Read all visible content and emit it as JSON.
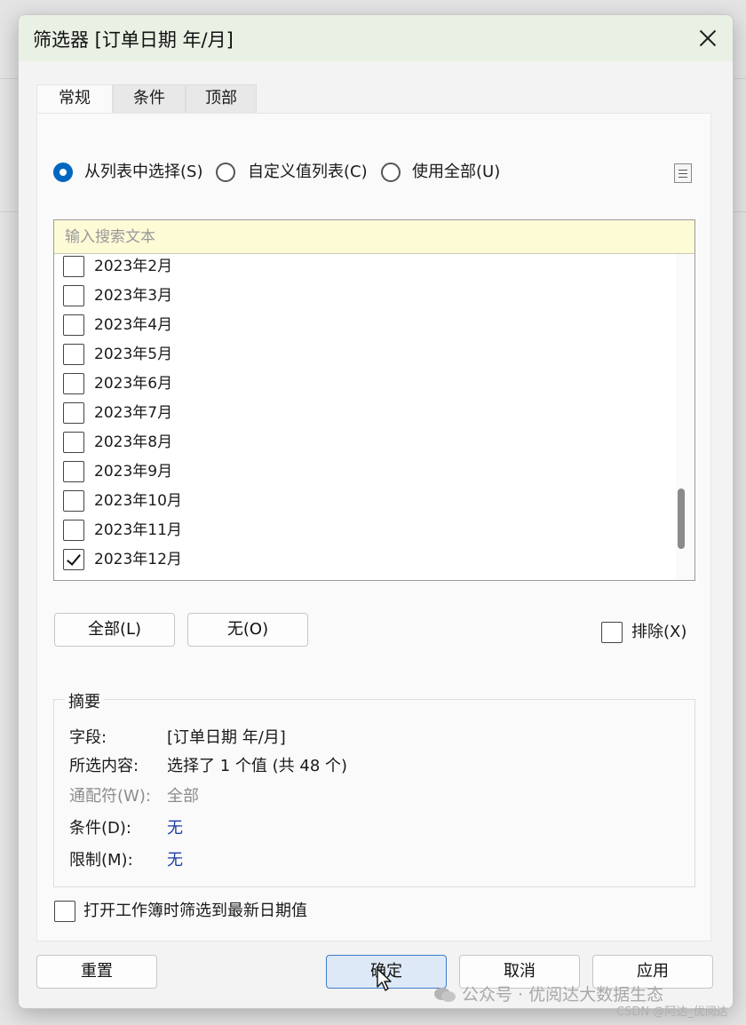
{
  "dialog": {
    "title": "筛选器 [订单日期 年/月]"
  },
  "tabs": [
    {
      "label": "常规",
      "active": true
    },
    {
      "label": "条件",
      "active": false
    },
    {
      "label": "顶部",
      "active": false
    }
  ],
  "mode": {
    "options": [
      {
        "label": "从列表中选择(S)",
        "selected": true
      },
      {
        "label": "自定义值列表(C)",
        "selected": false
      },
      {
        "label": "使用全部(U)",
        "selected": false
      }
    ]
  },
  "search": {
    "placeholder": "输入搜索文本",
    "value": ""
  },
  "items": [
    {
      "label": "2023年2月",
      "checked": false
    },
    {
      "label": "2023年3月",
      "checked": false
    },
    {
      "label": "2023年4月",
      "checked": false
    },
    {
      "label": "2023年5月",
      "checked": false
    },
    {
      "label": "2023年6月",
      "checked": false
    },
    {
      "label": "2023年7月",
      "checked": false
    },
    {
      "label": "2023年8月",
      "checked": false
    },
    {
      "label": "2023年9月",
      "checked": false
    },
    {
      "label": "2023年10月",
      "checked": false
    },
    {
      "label": "2023年11月",
      "checked": false
    },
    {
      "label": "2023年12月",
      "checked": true
    }
  ],
  "list_buttons": {
    "all_label": "全部(L)",
    "none_label": "无(O)",
    "exclude_label": "排除(X)",
    "exclude_checked": false
  },
  "summary": {
    "title": "摘要",
    "rows": [
      {
        "key": "字段:",
        "value": "[订单日期 年/月]"
      },
      {
        "key": "所选内容:",
        "value": "选择了 1 个值 (共 48 个)"
      },
      {
        "key": "通配符(W):",
        "value": "全部"
      },
      {
        "key": "条件(D):",
        "value": "无"
      },
      {
        "key": "限制(M):",
        "value": "无"
      }
    ]
  },
  "open_latest": {
    "label": "打开工作簿时筛选到最新日期值",
    "checked": false
  },
  "footer": {
    "reset_label": "重置",
    "ok_label": "确定",
    "cancel_label": "取消",
    "apply_label": "应用"
  },
  "watermark": {
    "text": "公众号 · 优阅达大数据生态",
    "csdn": "CSDN @阿达_优阅达"
  },
  "colors": {
    "accent": "#0067c0",
    "title_bar": "#e9f1e5",
    "search_bg": "#fdfad6",
    "link_blue": "#1b3fa8"
  },
  "icons": {
    "close": "close-icon",
    "list_menu": "list-menu-icon",
    "cursor": "mouse-cursor-icon",
    "wechat": "wechat-icon"
  }
}
